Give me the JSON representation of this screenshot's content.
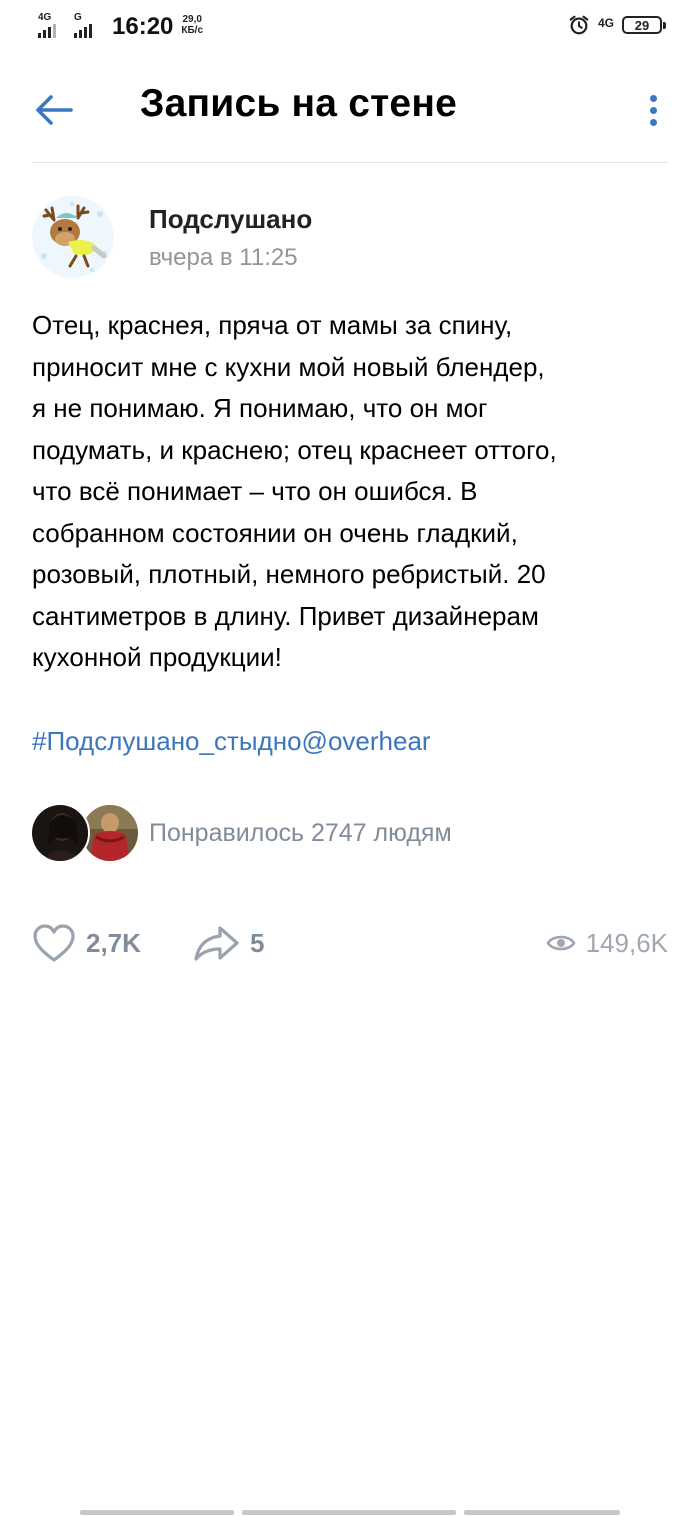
{
  "status_bar": {
    "sim1_network": "4G",
    "sim2_network": "G",
    "time": "16:20",
    "speed_value": "29,0",
    "speed_unit": "КБ/с",
    "right_network": "4G",
    "battery": "29"
  },
  "header": {
    "title": "Запись на стене",
    "icons": {
      "back": "arrow-left-icon",
      "more": "more-vertical-icon"
    },
    "accent_color": "#3a78c4"
  },
  "post": {
    "author": "Подслушано",
    "time": "вчера в 11:25",
    "text": "Отец, краснея, пряча от мамы за спину,\nприносит мне с кухни мой новый блендер,\nя не понимаю. Я понимаю, что он мог\nподумать, и краснею; отец краснеет оттого,\nчто всё понимает – что он ошибся. В\nсобранном состоянии он очень гладкий,\nрозовый, плотный, немного ребристый. 20\nсантиметров в длину. Привет дизайнерам\nкухонной продукции!",
    "hashtag": "#Подслушано_стыдно@overhear",
    "likers_text": "Понравилось 2747 людям",
    "likes": "2,7K",
    "shares": "5",
    "views": "149,6K",
    "link_color": "#3c76bc"
  }
}
